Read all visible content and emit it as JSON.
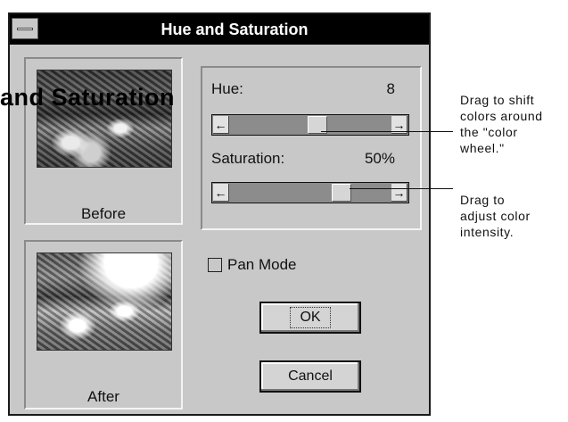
{
  "window": {
    "title": "Hue and Saturation"
  },
  "overlay_text": "and Saturation",
  "before": {
    "label": "Before"
  },
  "after": {
    "label": "After"
  },
  "hue": {
    "label": "Hue:",
    "value": "8",
    "position": 0.55
  },
  "saturation": {
    "label": "Saturation:",
    "value": "50%",
    "position": 0.72
  },
  "pan_mode": {
    "label": "Pan Mode",
    "checked": false
  },
  "buttons": {
    "ok": "OK",
    "cancel": "Cancel"
  },
  "callouts": {
    "hue_lines": [
      "Drag to shift",
      "colors around",
      "the \"color",
      "wheel.\""
    ],
    "saturation_lines": [
      "Drag to",
      "adjust color",
      "intensity."
    ]
  },
  "icons": {
    "scroll_left": "left-arrow-icon",
    "scroll_right": "right-arrow-icon",
    "system_menu": "system-menu-icon"
  }
}
